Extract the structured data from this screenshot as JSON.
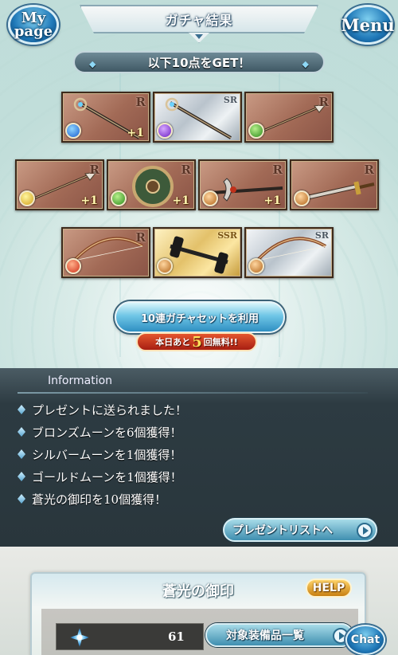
{
  "header": {
    "mypage_label": "My page",
    "mypage_line1": "My",
    "mypage_line2": "page",
    "title": "ガチャ結果",
    "menu_label": "Menu"
  },
  "get_banner": {
    "text": "以下10点をGET！"
  },
  "items": [
    {
      "rarity": "R",
      "element": "water",
      "plus": "+1",
      "weapon": "staff"
    },
    {
      "rarity": "SR",
      "element": "dark",
      "plus": "",
      "weapon": "staff"
    },
    {
      "rarity": "R",
      "element": "wind",
      "plus": "",
      "weapon": "spear"
    },
    {
      "rarity": "R",
      "element": "light",
      "plus": "+1",
      "weapon": "spear"
    },
    {
      "rarity": "R",
      "element": "wind",
      "plus": "+1",
      "weapon": "shield"
    },
    {
      "rarity": "R",
      "element": "earth",
      "plus": "+1",
      "weapon": "axe"
    },
    {
      "rarity": "R",
      "element": "earth",
      "plus": "",
      "weapon": "sword"
    },
    {
      "rarity": "R",
      "element": "fire",
      "plus": "",
      "weapon": "bow"
    },
    {
      "rarity": "SSR",
      "element": "earth",
      "plus": "",
      "weapon": "dumbbell"
    },
    {
      "rarity": "SR",
      "element": "earth",
      "plus": "",
      "weapon": "bow"
    }
  ],
  "pull_button": {
    "label": "10連ガチャセットを利用"
  },
  "free_badge": {
    "prefix": "本日あと",
    "count": "5",
    "suffix": "回無料!!"
  },
  "information": {
    "title": "Information",
    "items": [
      "プレゼントに送られました！",
      "ブロンズムーンを6個獲得！",
      "シルバームーンを1個獲得！",
      "ゴールドムーンを1個獲得！",
      "蒼光の御印を10個獲得！"
    ],
    "present_button": "プレゼントリストへ"
  },
  "seal": {
    "title": "蒼光の御印",
    "help": "HELP",
    "count": "61",
    "equip_button": "対象装備品一覧"
  },
  "chat": {
    "label": "Chat"
  },
  "colors": {
    "accent": "#2f8fc2",
    "info_bg": "#2d3b42",
    "badge_red": "#a71e12"
  }
}
